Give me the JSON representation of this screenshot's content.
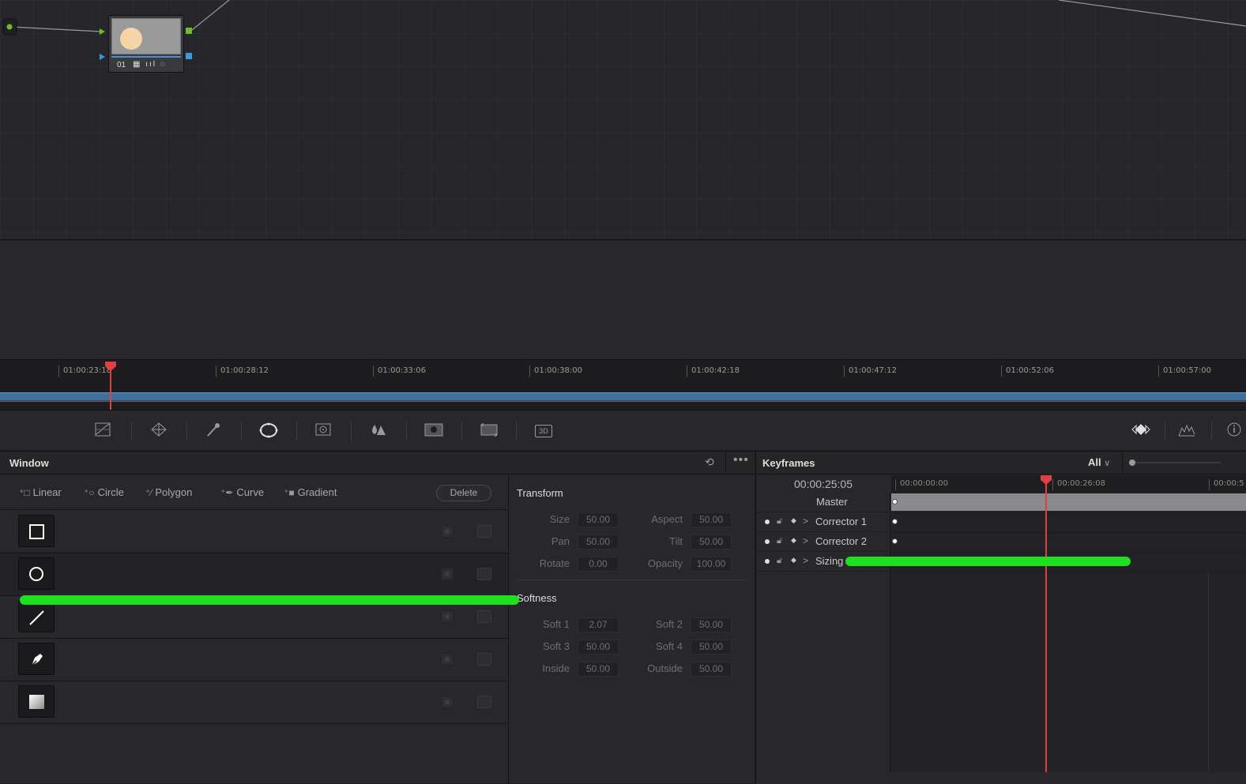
{
  "node_editor": {
    "node": {
      "label": "01",
      "icons": "▦ ııl ◌"
    }
  },
  "mini_timeline": {
    "timecodes": [
      "01:00:23:18",
      "01:00:28:12",
      "01:00:33:06",
      "01:00:38:00",
      "01:00:42:18",
      "01:00:47:12",
      "01:00:52:06",
      "01:00:57:00"
    ]
  },
  "palette_bar": {
    "icons": [
      "curves-icon",
      "color-warper-icon",
      "qualifier-icon",
      "window-icon",
      "tracker-icon",
      "blur-icon",
      "key-icon",
      "sizing-icon",
      "3d-icon",
      "keyframes-icon",
      "scopes-icon",
      "info-icon"
    ],
    "label_3d": "3D"
  },
  "window_panel": {
    "title": "Window",
    "tools": [
      "Linear",
      "Circle",
      "Polygon",
      "Curve",
      "Gradient"
    ],
    "delete_label": "Delete",
    "shapes": [
      "square-shape-icon",
      "circle-shape-icon",
      "line-shape-icon",
      "pen-shape-icon",
      "gradient-shape-icon"
    ]
  },
  "transform": {
    "title": "Transform",
    "size_label": "Size",
    "size": "50.00",
    "aspect_label": "Aspect",
    "aspect": "50.00",
    "pan_label": "Pan",
    "pan": "50.00",
    "tilt_label": "Tilt",
    "tilt": "50.00",
    "rotate_label": "Rotate",
    "rotate": "0.00",
    "opacity_label": "Opacity",
    "opacity": "100.00"
  },
  "softness": {
    "title": "Softness",
    "soft1_label": "Soft 1",
    "soft1": "2.07",
    "soft2_label": "Soft 2",
    "soft2": "50.00",
    "soft3_label": "Soft 3",
    "soft3": "50.00",
    "soft4_label": "Soft 4",
    "soft4": "50.00",
    "inside_label": "Inside",
    "inside": "50.00",
    "outside_label": "Outside",
    "outside": "50.00"
  },
  "keyframes": {
    "title": "Keyframes",
    "filter": "All",
    "timecode": "00:00:25:05",
    "ruler": [
      "00:00:00:00",
      "00:00:26:08",
      "00:00:5"
    ],
    "rows": [
      {
        "label": "Master"
      },
      {
        "label": "Corrector 1"
      },
      {
        "label": "Corrector 2"
      },
      {
        "label": "Sizing"
      }
    ]
  }
}
